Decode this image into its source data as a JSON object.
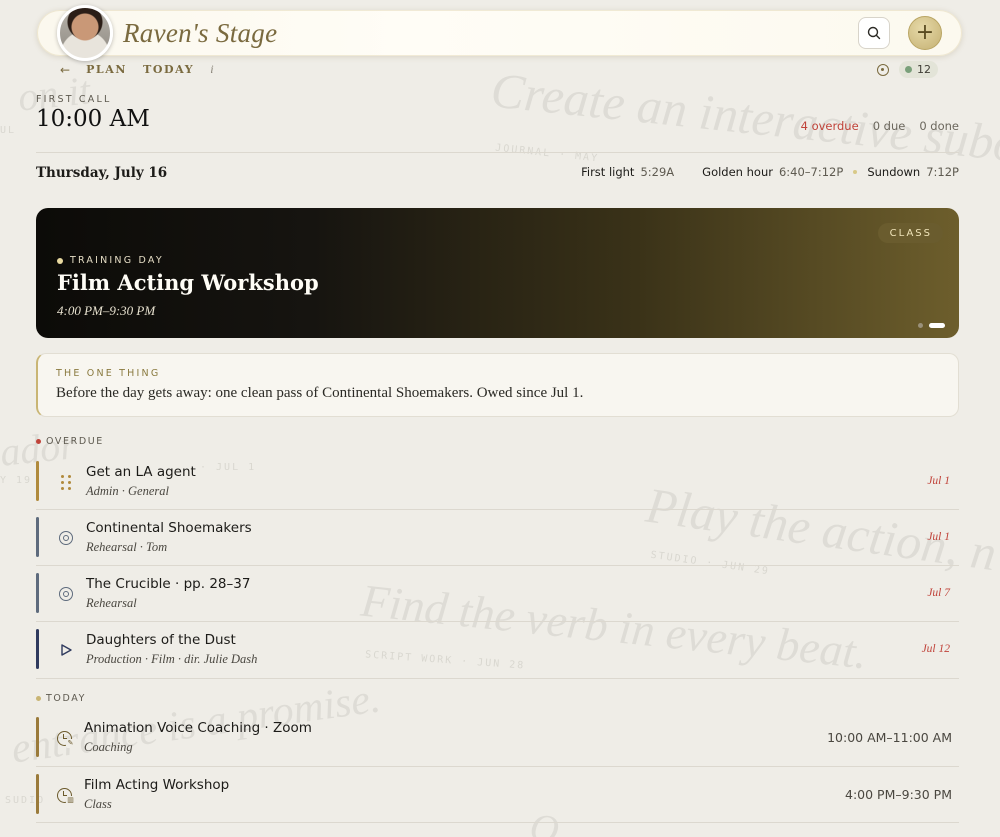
{
  "header": {
    "app_title": "Raven's Stage",
    "search_icon": "search-icon",
    "add_icon": "plus-icon",
    "add_label": "+"
  },
  "subnav": {
    "back_arrow": "←",
    "plan_label": "PLAN",
    "today_label": "TODAY",
    "info_label": "i",
    "counter": "12"
  },
  "first_call": {
    "label": "FIRST CALL",
    "time": "10:00 AM"
  },
  "summary": {
    "overdue": "4 overdue",
    "due": "0 due",
    "done": "0 done"
  },
  "date": "Thursday, July 16",
  "light": {
    "first_light_label": "First light",
    "first_light_value": "5:29A",
    "golden_label": "Golden hour",
    "golden_value": "6:40–7:12P",
    "sundown_label": "Sundown",
    "sundown_value": "7:12P"
  },
  "hero": {
    "badge": "CLASS",
    "kicker": "TRAINING DAY",
    "title": "Film Acting Workshop",
    "time": "4:00 PM–9:30 PM"
  },
  "one_thing": {
    "label": "THE ONE THING",
    "text": "Before the day gets away: one clean pass of Continental Shoemakers. Owed since Jul 1."
  },
  "overdue": {
    "label": "OVERDUE",
    "items": [
      {
        "title": "Get an LA agent",
        "meta": "Admin · General",
        "due": "Jul 1"
      },
      {
        "title": "Continental Shoemakers",
        "meta": "Rehearsal · Tom",
        "due": "Jul 1"
      },
      {
        "title": "The Crucible · pp. 28–37",
        "meta": "Rehearsal",
        "due": "Jul 7"
      },
      {
        "title": "Daughters of the Dust",
        "meta": "Production · Film · dir. Julie Dash",
        "due": "Jul 12"
      }
    ]
  },
  "today": {
    "label": "TODAY",
    "items": [
      {
        "title": "Animation Voice Coaching · Zoom",
        "meta": "Coaching",
        "time": "10:00 AM–11:00 AM"
      },
      {
        "title": "Film Acting Workshop",
        "meta": "Class",
        "time": "4:00 PM–9:30 PM"
      }
    ]
  },
  "colors": {
    "accent_gold": "#7a6a3f",
    "overdue_red": "#c0433a",
    "bar_brown": "#9a7a3a",
    "bar_slate": "#5e6b7d",
    "bar_navy": "#2f3a5e"
  }
}
